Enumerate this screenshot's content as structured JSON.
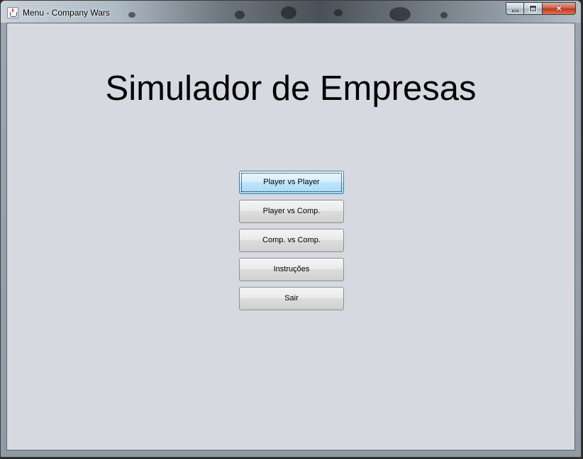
{
  "window": {
    "title": "Menu - Company Wars",
    "app_icon": "java-icon",
    "controls": {
      "minimize": "minimize-icon",
      "maximize": "maximize-icon",
      "close": "×"
    }
  },
  "main": {
    "heading": "Simulador de Empresas",
    "buttons": [
      {
        "label": "Player vs Player",
        "focused": true
      },
      {
        "label": "Player vs Comp.",
        "focused": false
      },
      {
        "label": "Comp. vs Comp.",
        "focused": false
      },
      {
        "label": "Instruções",
        "focused": false
      },
      {
        "label": "Sair",
        "focused": false
      }
    ]
  }
}
